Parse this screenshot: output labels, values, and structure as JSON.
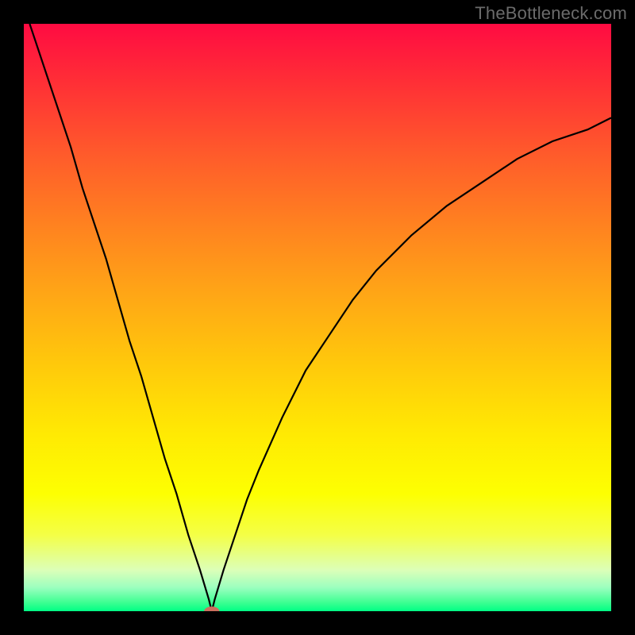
{
  "watermark": "TheBottleneck.com",
  "chart_data": {
    "type": "line",
    "title": "",
    "xlabel": "",
    "ylabel": "",
    "xlim": [
      0,
      100
    ],
    "ylim": [
      0,
      100
    ],
    "grid": false,
    "legend": false,
    "minimum_point": {
      "x": 32,
      "y": 0
    },
    "curve": {
      "description": "V-shaped curve; right arm rises concave approaching 100, left arm rises steeply to 100 at x≈1",
      "x": [
        1,
        2,
        4,
        6,
        8,
        10,
        12,
        14,
        16,
        18,
        20,
        22,
        24,
        26,
        28,
        30,
        31.5,
        32,
        32.5,
        34,
        36,
        38,
        40,
        44,
        48,
        52,
        56,
        60,
        66,
        72,
        78,
        84,
        90,
        96,
        100
      ],
      "y": [
        100,
        97,
        91,
        85,
        79,
        72,
        66,
        60,
        53,
        46,
        40,
        33,
        26,
        20,
        13,
        7,
        2,
        0,
        2,
        7,
        13,
        19,
        24,
        33,
        41,
        47,
        53,
        58,
        64,
        69,
        73,
        77,
        80,
        82,
        84
      ]
    },
    "background_gradient": {
      "stops": [
        {
          "pos": 0.0,
          "color": "#ff0b42"
        },
        {
          "pos": 0.5,
          "color": "#ffc90b"
        },
        {
          "pos": 0.9,
          "color": "#f4ff46"
        },
        {
          "pos": 1.0,
          "color": "#00ff85"
        }
      ]
    },
    "marker": {
      "shape": "ellipse",
      "x": 32,
      "y": 0,
      "rx": 1.3,
      "ry": 0.8,
      "color": "#cc6f5e"
    }
  }
}
